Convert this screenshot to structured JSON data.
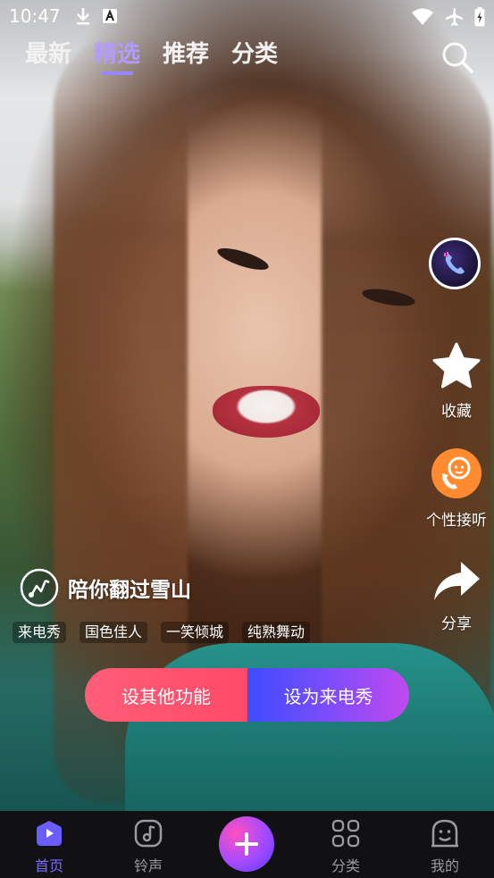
{
  "status_bar": {
    "time": "10:47",
    "left_icons": [
      "download-icon",
      "font-a-icon"
    ],
    "right_icons": [
      "wifi-icon",
      "airplane-icon",
      "battery-icon"
    ]
  },
  "top_tabs": [
    {
      "label": "最新",
      "active": false
    },
    {
      "label": "精选",
      "active": true
    },
    {
      "label": "推荐",
      "active": false
    },
    {
      "label": "分类",
      "active": false
    }
  ],
  "side_actions": {
    "collect_label": "收藏",
    "personal_answer_label": "个性接听",
    "share_label": "分享"
  },
  "song": {
    "title": "陪你翻过雪山"
  },
  "tags": [
    "来电秀",
    "国色佳人",
    "一笑倾城",
    "纯熟舞动"
  ],
  "buttons": {
    "other_label": "设其他功能",
    "set_label": "设为来电秀"
  },
  "bottom_nav": {
    "home_label": "首页",
    "ringtone_label": "铃声",
    "category_label": "分类",
    "mine_label": "我的"
  },
  "colors": {
    "accent": "#7b6bff",
    "pink_button": "#ff4a68",
    "purple_button": "#8a4cf8"
  }
}
